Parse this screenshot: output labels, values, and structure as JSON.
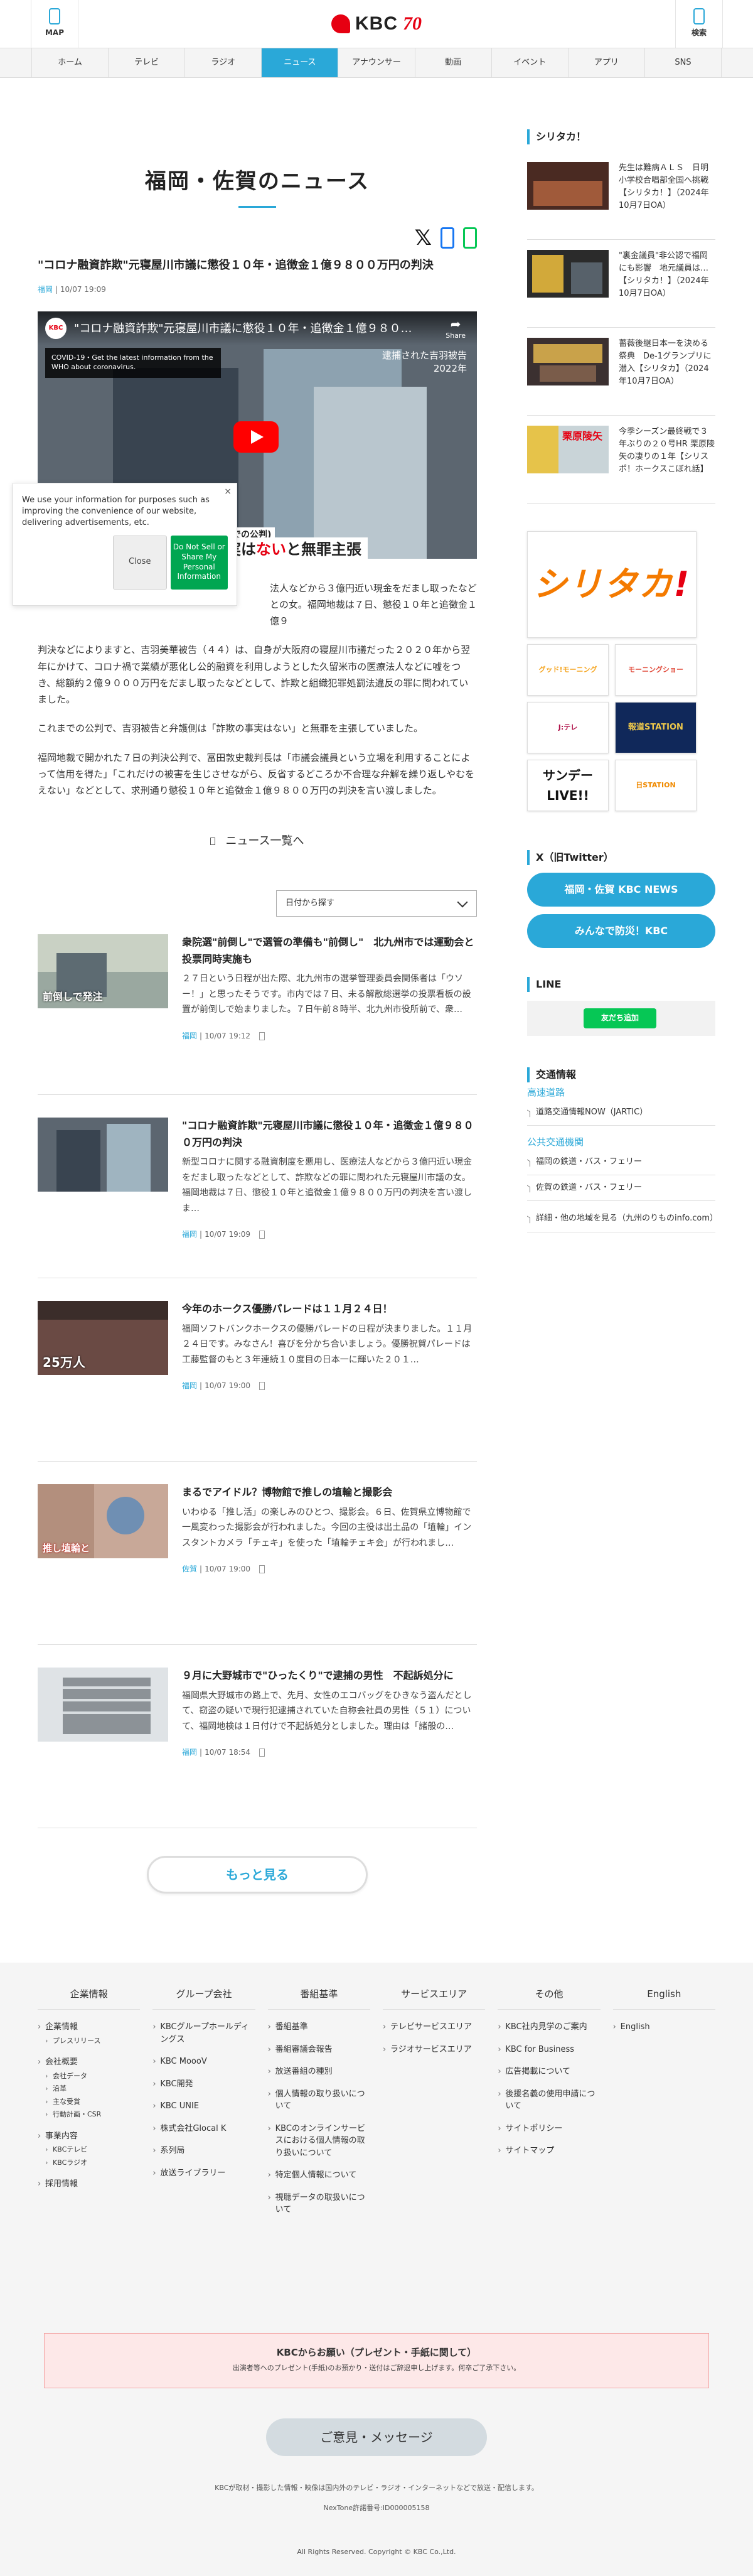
{
  "header": {
    "map_label": "MAP",
    "search_label": "検索",
    "logo_text": "KBC",
    "logo_anniv": "70"
  },
  "nav": {
    "items": [
      "ホーム",
      "テレビ",
      "ラジオ",
      "ニュース",
      "アナウンサー",
      "動画",
      "イベント",
      "アプリ",
      "SNS"
    ],
    "active": "ニュース"
  },
  "page": {
    "title": "福岡・佐賀のニュース"
  },
  "share": {
    "x": "𝕏"
  },
  "article": {
    "title": "\"コロナ融資詐欺\"元寝屋川市議に懲役１０年・追徴金１億９８００万円の判決",
    "area": "福岡",
    "date": "10/07 19:09",
    "video": {
      "channel": "KBC",
      "title": "\"コロナ融資詐欺\"元寝屋川市議に懲役１０年・追徴金１億９８０…",
      "share": "Share",
      "covid": "COVID-19・Get the latest information from the WHO about coronavirus.",
      "badge1": "逮捕された吉羽被告",
      "badge2": "2022年",
      "caption_small": "までの公判)",
      "caption_pre": "実は",
      "caption_red": "ない",
      "caption_post": "と無罪主張"
    },
    "p1_tail": "法人などから３億円近い現金をだまし取ったなどとの女。福岡地裁は７日、懲役１０年と追徴金１億９",
    "p2": "判決などによりますと、吉羽美華被告（４４）は、自身が大阪府の寝屋川市議だった２０２０年から翌年にかけて、コロナ禍で業績が悪化し公的融資を利用しようとした久留米市の医療法人などに嘘をつき、総額約２億９０００万円をだまし取ったなどとして、詐欺と組織犯罪処罰法違反の罪に問われていました。",
    "p3": "これまでの公判で、吉羽被告と弁護側は「詐欺の事実はない」と無罪を主張していました。",
    "p4": "福岡地裁で開かれた７日の判決公判で、冨田敦史裁判長は「市議会議員という立場を利用することによって信用を得た」「これだけの被害を生じさせながら、反省するどころか不合理な弁解を繰り返しやむをえない」などとして、求刑通り懲役１０年と追徴金１億９８００万円の判決を言い渡しました。"
  },
  "consent": {
    "message": "We use your information for purposes such as improving the convenience of our website, delivering advertisements, etc.",
    "close_x": "×",
    "close": "Close",
    "dns": "Do Not Sell or Share My Personal Information"
  },
  "list": {
    "link_label": "ニュース一覧へ",
    "date_select": "日付から探す",
    "items": [
      {
        "title": "衆院選\"前倒し\"で選管の準備も\"前倒し\"　北九州市では運動会と投票同時実施も",
        "desc": "２７日という日程が出た際、北九州市の選挙管理委員会関係者は「ウソー！」と思ったそうです。市内では７日、未る解散総選挙の投票看板の設置が前倒しで始まりました。７日午前８時半、北九州市役所前で、衆…",
        "area": "福岡",
        "date": "10/07 19:12",
        "thumb_caption": "前倒しで発注"
      },
      {
        "title": "\"コロナ融資詐欺\"元寝屋川市議に懲役１０年・追徴金１億９８００万円の判決",
        "desc": "新型コロナに関する融資制度を悪用し、医療法人などから３億円近い現金をだまし取ったなどとして、詐欺などの罪に問われた元寝屋川市議の女。福岡地裁は７日、懲役１０年と追徴金１億９８００万円の判決を言い渡しま…",
        "area": "福岡",
        "date": "10/07 19:09",
        "thumb_caption": ""
      },
      {
        "title": "今年のホークス優勝パレードは１１月２４日！",
        "desc": "福岡ソフトバンクホークスの優勝パレードの日程が決まりました。１１月２４日です。みなさん！喜びを分かち合いましょう。優勝祝賀パレードは工藤監督のもと３年連続１０度目の日本一に輝いた２０１…",
        "area": "福岡",
        "date": "10/07 19:00",
        "thumb_caption": "25万人"
      },
      {
        "title": "まるでアイドル？博物館で推しの埴輪と撮影会",
        "desc": "いわゆる「推し活」の楽しみのひとつ、撮影会。６日、佐賀県立博物館で一風変わった撮影会が行われました。今回の主役は出土品の「埴輪」インスタントカメラ「チェキ」を使った「埴輪チェキ会」が行われまし…",
        "area": "佐賀",
        "date": "10/07 19:00",
        "thumb_caption": "推し埴輪と"
      },
      {
        "title": "９月に大野城市で\"ひったくり\"で逮捕の男性　不起訴処分に",
        "desc": "福岡県大野城市の路上で、先月、女性のエコバッグをひきなう盗んだとして、窃盗の疑いで現行犯逮捕されていた自称会社員の男性（５１）について、福岡地検は１日付けで不起訴処分としました。理由は「諸般の…",
        "area": "福岡",
        "date": "10/07 18:54",
        "thumb_caption": ""
      }
    ],
    "more_button": "もっと見る"
  },
  "sidebar": {
    "shiritaka_heading": "シリタカ！",
    "shiritaka_items": [
      {
        "text": "先生は難病ＡＬＳ　日明小学校合唱部全国へ挑戦【シリタカ！】（2024年10月7日OA）",
        "thumb": "stage"
      },
      {
        "text": "\"裏金議員\"非公認で福岡にも影響　地元議員は…【シリタカ！】（2024年10月7日OA）",
        "thumb": "talk"
      },
      {
        "text": "薔薇後継日本一を決める祭典　De-1グランプリに潜入【シリタカ】（2024年10月7日OA）",
        "thumb": "event"
      },
      {
        "text": "今季シーズン最終戦で３年ぶりの２０号HR 栗原陵矢の凄りの１年【シリスポ！ホークスこぼれ話】",
        "thumb": "baseball"
      }
    ],
    "thumb_baseball_caption": "栗原陵矢",
    "banner_big_a": "シリタカ",
    "banner_big_b": "!",
    "banners": [
      "グッド!モーニング",
      "モーニングショー",
      "J:テレ",
      "報道STATION",
      "サンデーLIVE!!",
      "日STATION"
    ],
    "twitter_heading": "X（旧Twitter）",
    "twitter_buttons": [
      "福岡・佐賀 KBC NEWS",
      "みんなで防災！KBC"
    ],
    "line_heading": "LINE",
    "line_button": "友だち追加",
    "traffic_heading": "交通情報",
    "traffic_highway": "高速道路",
    "traffic_highway_items": [
      "道路交通情報NOW（JARTIC）"
    ],
    "traffic_public": "公共交通機関",
    "traffic_public_items": [
      "福岡の鉄道・バス・フェリー",
      "佐賀の鉄道・バス・フェリー"
    ],
    "traffic_more": "詳細・他の地域を見る（九州のりものinfo.com）"
  },
  "footer": {
    "columns": [
      {
        "title": "企業情報",
        "items": [
          {
            "label": "企業情報",
            "sub": [
              "プレスリリース"
            ]
          },
          {
            "label": "会社概要",
            "sub": [
              "会社データ",
              "沿革",
              "主な受賞",
              "行動計画・CSR"
            ]
          },
          {
            "label": "事業内容",
            "sub": [
              "KBCテレビ",
              "KBCラジオ"
            ]
          },
          {
            "label": "採用情報",
            "sub": []
          }
        ]
      },
      {
        "title": "グループ会社",
        "items": [
          {
            "label": "KBCグループホールディングス",
            "sub": []
          },
          {
            "label": "KBC MoooV",
            "sub": []
          },
          {
            "label": "KBC開発",
            "sub": []
          },
          {
            "label": "KBC UNIE",
            "sub": []
          },
          {
            "label": "株式会社Glocal K",
            "sub": []
          },
          {
            "label": "系列局",
            "sub": []
          },
          {
            "label": "放送ライブラリー",
            "sub": []
          }
        ]
      },
      {
        "title": "番組基準",
        "items": [
          {
            "label": "番組基準",
            "sub": []
          },
          {
            "label": "番組審議会報告",
            "sub": []
          },
          {
            "label": "放送番組の種別",
            "sub": []
          },
          {
            "label": "個人情報の取り扱いについて",
            "sub": []
          },
          {
            "label": "KBCのオンラインサービスにおける個人情報の取り扱いについて",
            "sub": []
          },
          {
            "label": "特定個人情報について",
            "sub": []
          },
          {
            "label": "視聴データの取扱いについて",
            "sub": []
          }
        ]
      },
      {
        "title": "サービスエリア",
        "items": [
          {
            "label": "テレビサービスエリア",
            "sub": []
          },
          {
            "label": "ラジオサービスエリア",
            "sub": []
          }
        ]
      },
      {
        "title": "その他",
        "items": [
          {
            "label": "KBC社内見学のご案内",
            "sub": []
          },
          {
            "label": "KBC for Business",
            "sub": []
          },
          {
            "label": "広告掲載について",
            "sub": []
          },
          {
            "label": "後援名義の使用申請について",
            "sub": []
          },
          {
            "label": "サイトポリシー",
            "sub": []
          },
          {
            "label": "サイトマップ",
            "sub": []
          }
        ]
      },
      {
        "title": "English",
        "items": [
          {
            "label": "English",
            "sub": []
          }
        ]
      }
    ],
    "present_title": "KBCからお願い（プレゼント・手紙に関して）",
    "present_sub": "出演者等へのプレゼント(手紙)のお預かり・送付はご辞退申し上げます。何卒ご了承下さい。",
    "opinion_button": "ご意見・メッセージ",
    "note": "KBCが取材・撮影した情報・映像は国内外のテレビ・ラジオ・インターネットなどで放送・配信します。",
    "nettore": "NexTone許諾番号:ID000005158",
    "copyright": "All Rights Reserved. Copyright © KBC Co.,Ltd."
  },
  "colors": {
    "accent": "#2aa8d8",
    "brand_red": "#e60012",
    "line_green": "#06c755"
  }
}
